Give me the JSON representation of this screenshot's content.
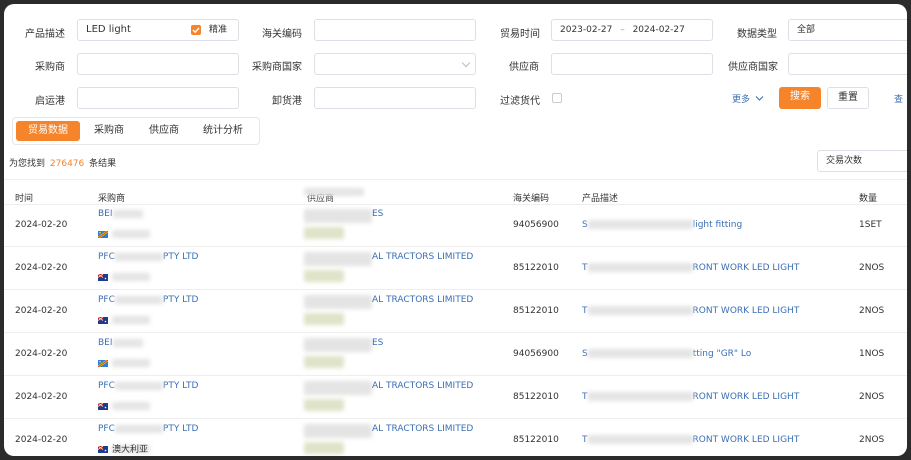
{
  "form": {
    "product_desc_label": "产品描述",
    "product_desc_value": "LED light",
    "exact_label": "精准",
    "hs_code_label": "海关编码",
    "trade_time_label": "贸易时间",
    "date_start": "2023-02-27",
    "date_sep": "–",
    "date_end": "2024-02-27",
    "data_type_label": "数据类型",
    "data_type_value": "全部",
    "buyer_label": "采购商",
    "buyer_country_label": "采购商国家",
    "supplier_label": "供应商",
    "supplier_country_label": "供应商国家",
    "origin_port_label": "启运港",
    "dest_port_label": "卸货港",
    "filter_forwarder_label": "过滤货代",
    "more_label": "更多",
    "search_button": "搜索",
    "reset_button": "重置",
    "query_link": "查"
  },
  "tabs": [
    {
      "label": "贸易数据",
      "active": true
    },
    {
      "label": "采购商",
      "active": false
    },
    {
      "label": "供应商",
      "active": false
    },
    {
      "label": "统计分析",
      "active": false
    }
  ],
  "results": {
    "prefix": "为您找到",
    "count": "276476",
    "suffix": "条结果",
    "sort_value": "交易次数"
  },
  "table": {
    "headers": [
      "时间",
      "采购商",
      "供应商",
      "海关编码",
      "产品描述",
      "数量"
    ],
    "rows": [
      {
        "date": "2024-02-20",
        "buyer_a": "BEI",
        "buyer_b": "",
        "supplier_a": "",
        "supplier_b": "ES",
        "hs": "94056900",
        "desc_a": "S",
        "desc_b": "light fitting",
        "qty": "1SET",
        "flag": "cd",
        "country": ""
      },
      {
        "date": "2024-02-20",
        "buyer_a": "PFC",
        "buyer_b": "PTY LTD",
        "supplier_a": "",
        "supplier_b": "AL TRACTORS LIMITED",
        "hs": "85122010",
        "desc_a": "T",
        "desc_b": "RONT WORK LED LIGHT",
        "qty": "2NOS",
        "flag": "au",
        "country": ""
      },
      {
        "date": "2024-02-20",
        "buyer_a": "PFC",
        "buyer_b": "PTY LTD",
        "supplier_a": "",
        "supplier_b": "AL TRACTORS LIMITED",
        "hs": "85122010",
        "desc_a": "T",
        "desc_b": "RONT WORK LED LIGHT",
        "qty": "2NOS",
        "flag": "au",
        "country": ""
      },
      {
        "date": "2024-02-20",
        "buyer_a": "BEI",
        "buyer_b": "",
        "supplier_a": "",
        "supplier_b": "ES",
        "hs": "94056900",
        "desc_a": "S",
        "desc_b": "tting \"GR\" Lo",
        "qty": "1NOS",
        "flag": "cd",
        "country": ""
      },
      {
        "date": "2024-02-20",
        "buyer_a": "PFC",
        "buyer_b": "PTY LTD",
        "supplier_a": "",
        "supplier_b": "AL TRACTORS LIMITED",
        "hs": "85122010",
        "desc_a": "T",
        "desc_b": "RONT WORK LED LIGHT",
        "qty": "2NOS",
        "flag": "au",
        "country": ""
      },
      {
        "date": "2024-02-20",
        "buyer_a": "PFC",
        "buyer_b": "PTY LTD",
        "supplier_a": "",
        "supplier_b": "AL TRACTORS LIMITED",
        "hs": "85122010",
        "desc_a": "T",
        "desc_b": "RONT WORK LED LIGHT",
        "qty": "2NOS",
        "flag": "au",
        "country": "澳大利亚"
      }
    ]
  },
  "colors": {
    "accent": "#f5842b",
    "link": "#3a6fb5"
  }
}
